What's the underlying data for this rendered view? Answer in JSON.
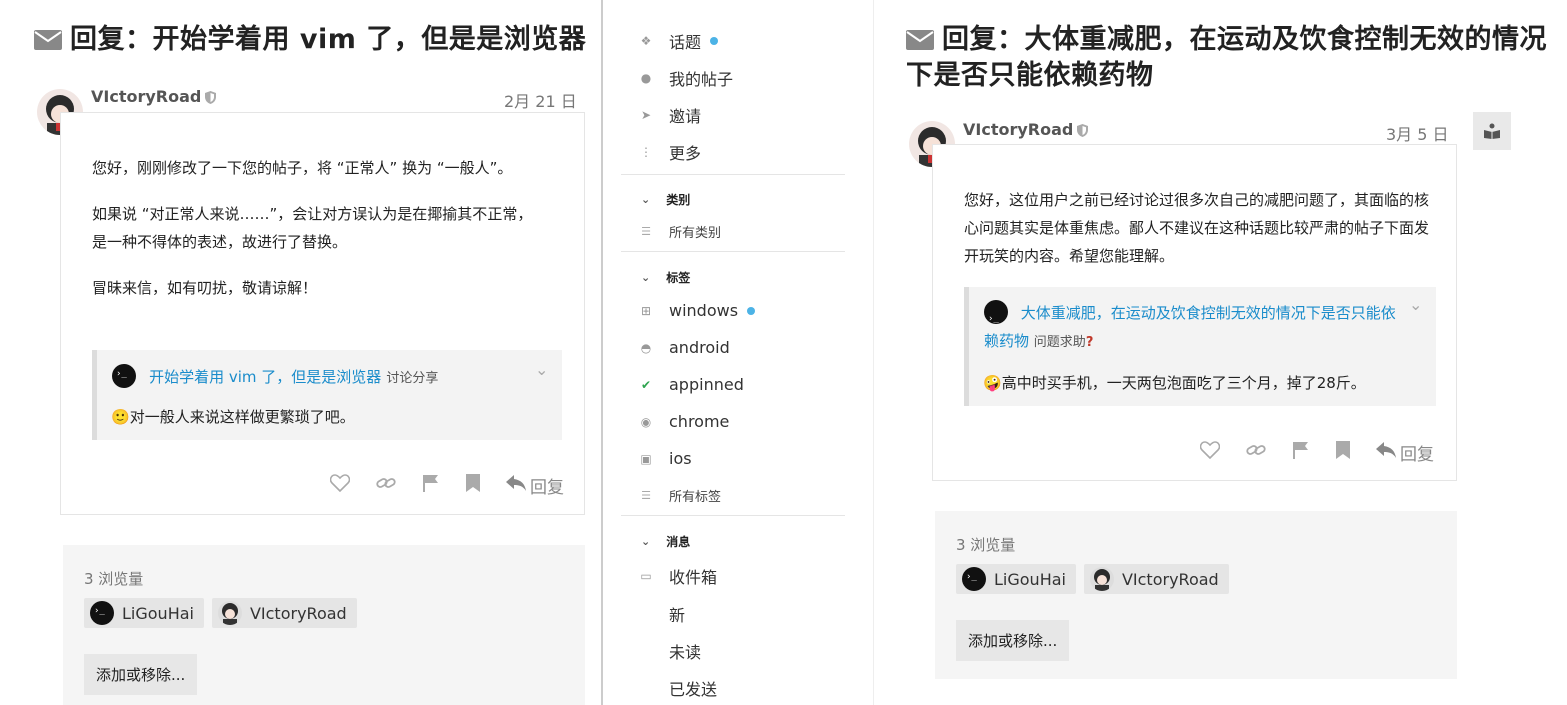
{
  "left": {
    "title": "回复：开始学着用 vim 了，但是是浏览器",
    "username": "VIctoryRoad",
    "date": "2月 21 日",
    "body": [
      "您好，刚刚修改了一下您的帖子，将 “正常人” 换为 “一般人”。",
      "如果说 “对正常人来说……”，会让对方误认为是在揶揄其不正常，是一种不得体的表述，故进行了替换。",
      "冒昧来信，如有叨扰，敬请谅解！"
    ],
    "quote": {
      "title": "开始学着用 vim 了，但是是浏览器",
      "category": "讨论分享",
      "emoji": "🙂",
      "text": "对一般人来说这样做更繁琐了吧。"
    },
    "reply_label": "回复",
    "views": "3 浏览量",
    "participants": [
      "LiGouHai",
      "VIctoryRoad"
    ],
    "add_remove_label": "添加或移除..."
  },
  "sidebar": {
    "top_items": [
      {
        "label": "话题",
        "icon": "layers-icon",
        "dot": true
      },
      {
        "label": "我的帖子",
        "icon": "user-icon",
        "dot": false
      },
      {
        "label": "邀请",
        "icon": "send-icon",
        "dot": false
      },
      {
        "label": "更多",
        "icon": "more-icon",
        "dot": false
      }
    ],
    "categories_header": "类别",
    "all_categories": "所有类别",
    "tags_header": "标签",
    "tags": [
      {
        "label": "windows",
        "icon": "windows-icon",
        "dot": true
      },
      {
        "label": "android",
        "icon": "android-icon",
        "dot": false
      },
      {
        "label": "appinned",
        "icon": "check-icon",
        "dot": false
      },
      {
        "label": "chrome",
        "icon": "chrome-icon",
        "dot": false
      },
      {
        "label": "ios",
        "icon": "appstore-icon",
        "dot": false
      }
    ],
    "all_tags": "所有标签",
    "messages_header": "消息",
    "inbox": "收件箱",
    "message_items": [
      "新",
      "未读",
      "已发送"
    ]
  },
  "right": {
    "title_line1": "回复：大体重减肥，在运动及饮食控制无效的情况",
    "title_line2": "下是否只能依赖药物",
    "username": "VIctoryRoad",
    "date": "3月 5 日",
    "body": "您好，这位用户之前已经讨论过很多次自己的减肥问题了，其面临的核心问题其实是体重焦虑。鄙人不建议在这种话题比较严肃的帖子下面发开玩笑的内容。希望您能理解。",
    "quote": {
      "title": "大体重减肥，在运动及饮食控制无效的情况下是否只能依赖药物",
      "category": "问题求助",
      "emoji": "🤪",
      "text": "高中时买手机，一天两包泡面吃了三个月，掉了28斤。"
    },
    "reply_label": "回复",
    "views": "3 浏览量",
    "participants": [
      "LiGouHai",
      "VIctoryRoad"
    ],
    "add_remove_label": "添加或移除..."
  }
}
